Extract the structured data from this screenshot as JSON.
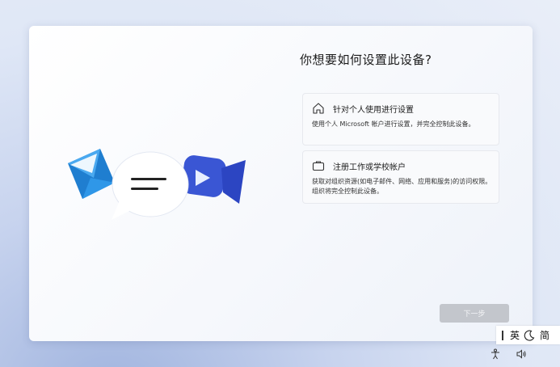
{
  "dialog": {
    "title": "你想要如何设置此设备?",
    "options": [
      {
        "icon": "home-icon",
        "heading": "针对个人使用进行设置",
        "description": "使用个人 Microsoft 帐户进行设置，并完全控制此设备。"
      },
      {
        "icon": "briefcase-icon",
        "heading": "注册工作或学校帐户",
        "description": "获取对组织资源(如电子邮件、网络、应用和服务)的访问权限。组织将完全控制此设备。"
      }
    ],
    "next_label": "下一步",
    "illustration": [
      "mail-icon",
      "chat-bubble-icon",
      "video-call-icon"
    ]
  },
  "ime": {
    "cursor": "I",
    "language": "英",
    "mode_icon": "moon-icon",
    "mode": "简"
  },
  "tray": {
    "icons": [
      "accessibility-icon",
      "volume-icon"
    ]
  },
  "colors": {
    "mail_blue": "#2a8ee0",
    "video_blue": "#3b5bdb",
    "button_disabled": "#c3c6cc"
  }
}
